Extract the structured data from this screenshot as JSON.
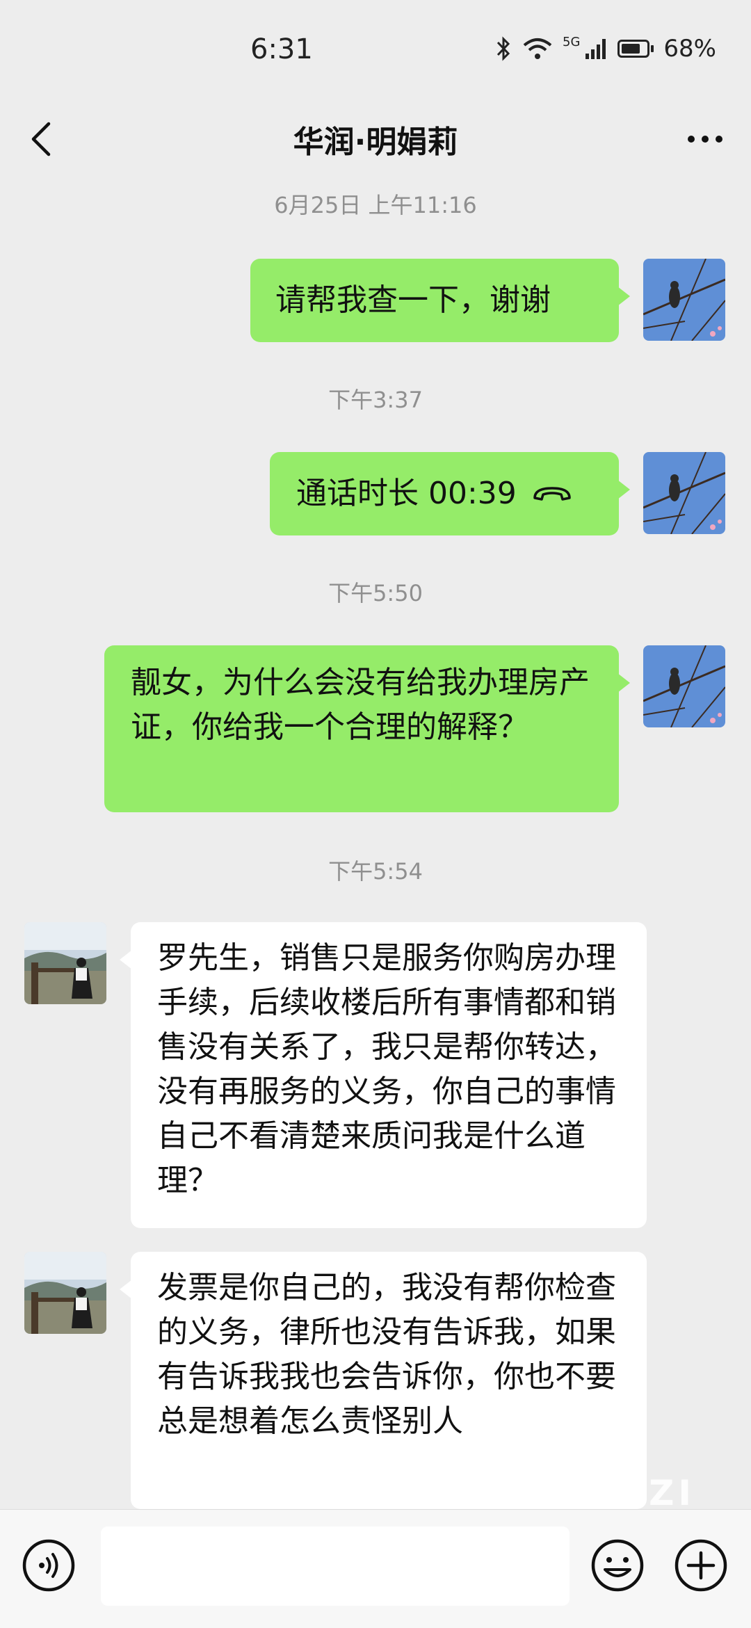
{
  "status_bar": {
    "time": "6:31",
    "network": "5G",
    "battery": "68%",
    "icons": [
      "bluetooth-icon",
      "wifi-icon",
      "signal-icon",
      "battery-icon"
    ]
  },
  "header": {
    "title": "华润·明娟莉",
    "back_icon": "chevron-left-icon",
    "more_icon": "more-dots-icon"
  },
  "messages": [
    {
      "type": "timestamp",
      "text": "6月25日 上午11:16"
    },
    {
      "type": "message",
      "sender": "me",
      "text": "请帮我查一下，谢谢"
    },
    {
      "type": "timestamp",
      "text": "下午3:37"
    },
    {
      "type": "call",
      "sender": "me",
      "text": "通话时长 00:39",
      "icon": "phone-hangup-icon"
    },
    {
      "type": "timestamp",
      "text": "下午5:50"
    },
    {
      "type": "message",
      "sender": "me",
      "text": "靓女，为什么会没有给我办理房产证，你给我一个合理的解释？"
    },
    {
      "type": "timestamp",
      "text": "下午5:54"
    },
    {
      "type": "message",
      "sender": "other",
      "text": "罗先生，销售只是服务你购房办理手续，后续收楼后所有事情都和销售没有关系了，我只是帮你转达，没有再服务的义务，你自己的事情自己不看清楚来质问我是什么道理？"
    },
    {
      "type": "message",
      "sender": "other",
      "text": "发票是你自己的，我没有帮你检查的义务，律所也没有告诉我，如果有告诉我我也会告诉你，你也不要总是想着怎么责怪别人"
    }
  ],
  "watermark": "XIZI",
  "input_bar": {
    "voice_icon": "voice-icon",
    "emoji_icon": "emoji-icon",
    "plus_icon": "plus-icon",
    "value": ""
  },
  "colors": {
    "background": "#ededed",
    "my_bubble": "#95ec69",
    "their_bubble": "#ffffff",
    "timestamp": "#8f8f8f"
  }
}
